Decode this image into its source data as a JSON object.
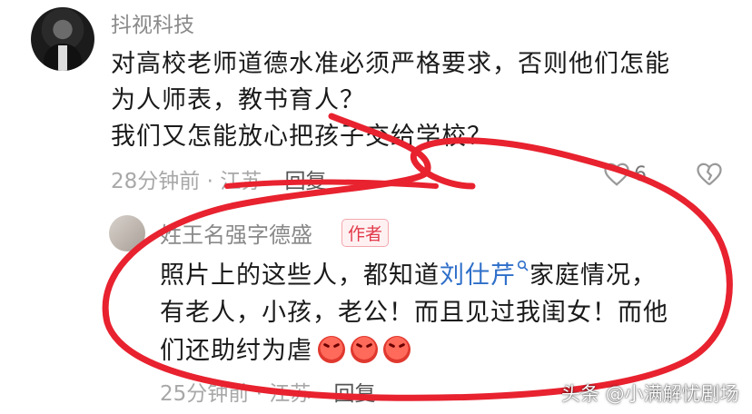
{
  "comment": {
    "username": "抖视科技",
    "lines": [
      "对高校老师道德水准必须严格要求，否则他们怎能",
      "为人师表，教书育人？",
      "我们又怎能放心把孩子交给学校？"
    ],
    "time": "28分钟前",
    "location": "江苏",
    "reply_label": "回复",
    "like_count": "6"
  },
  "reply": {
    "username": "姓王名强字德盛",
    "badge": "作者",
    "line1_prefix": "照片上的这些人，都知道",
    "mention": "刘仕芹",
    "line1_suffix": "家庭情况，",
    "line2": "有老人，小孩，老公！而且见过我闺女！而他",
    "line3": "们还助纣为虐",
    "emojis": [
      "angry-emoji",
      "angry-emoji",
      "angry-emoji"
    ],
    "time": "25分钟前",
    "location": "江苏",
    "reply_label": "回复"
  },
  "watermark": "头条 @小满解忧剧场",
  "colors": {
    "mention": "#2e6fc9",
    "badge": "#e23b4b",
    "scribble": "#e8222f"
  }
}
